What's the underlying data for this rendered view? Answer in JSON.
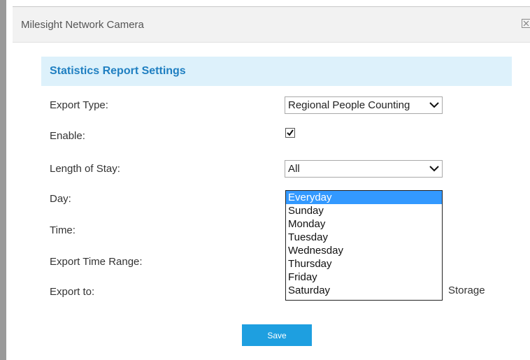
{
  "window": {
    "title": "Milesight Network Camera",
    "close_icon": "close-icon"
  },
  "section": {
    "title": "Statistics Report Settings"
  },
  "fields": {
    "export_type": {
      "label": "Export Type:",
      "value": "Regional People Counting"
    },
    "enable": {
      "label": "Enable:",
      "checked": true
    },
    "length_of_stay": {
      "label": "Length of Stay:",
      "value": "All"
    },
    "day": {
      "label": "Day:",
      "options": [
        "Everyday",
        "Sunday",
        "Monday",
        "Tuesday",
        "Wednesday",
        "Thursday",
        "Friday",
        "Saturday"
      ],
      "selected": "Everyday"
    },
    "time": {
      "label": "Time:"
    },
    "export_time_range": {
      "label": "Export Time Range:"
    },
    "export_to": {
      "label": "Export to:",
      "partial_text": "Storage"
    }
  },
  "actions": {
    "save_label": "Save"
  },
  "colors": {
    "accent": "#1e9fe0",
    "section_bg": "#ddf1fb",
    "section_title": "#1f7fc1",
    "selected_option_bg": "#3399ff"
  }
}
